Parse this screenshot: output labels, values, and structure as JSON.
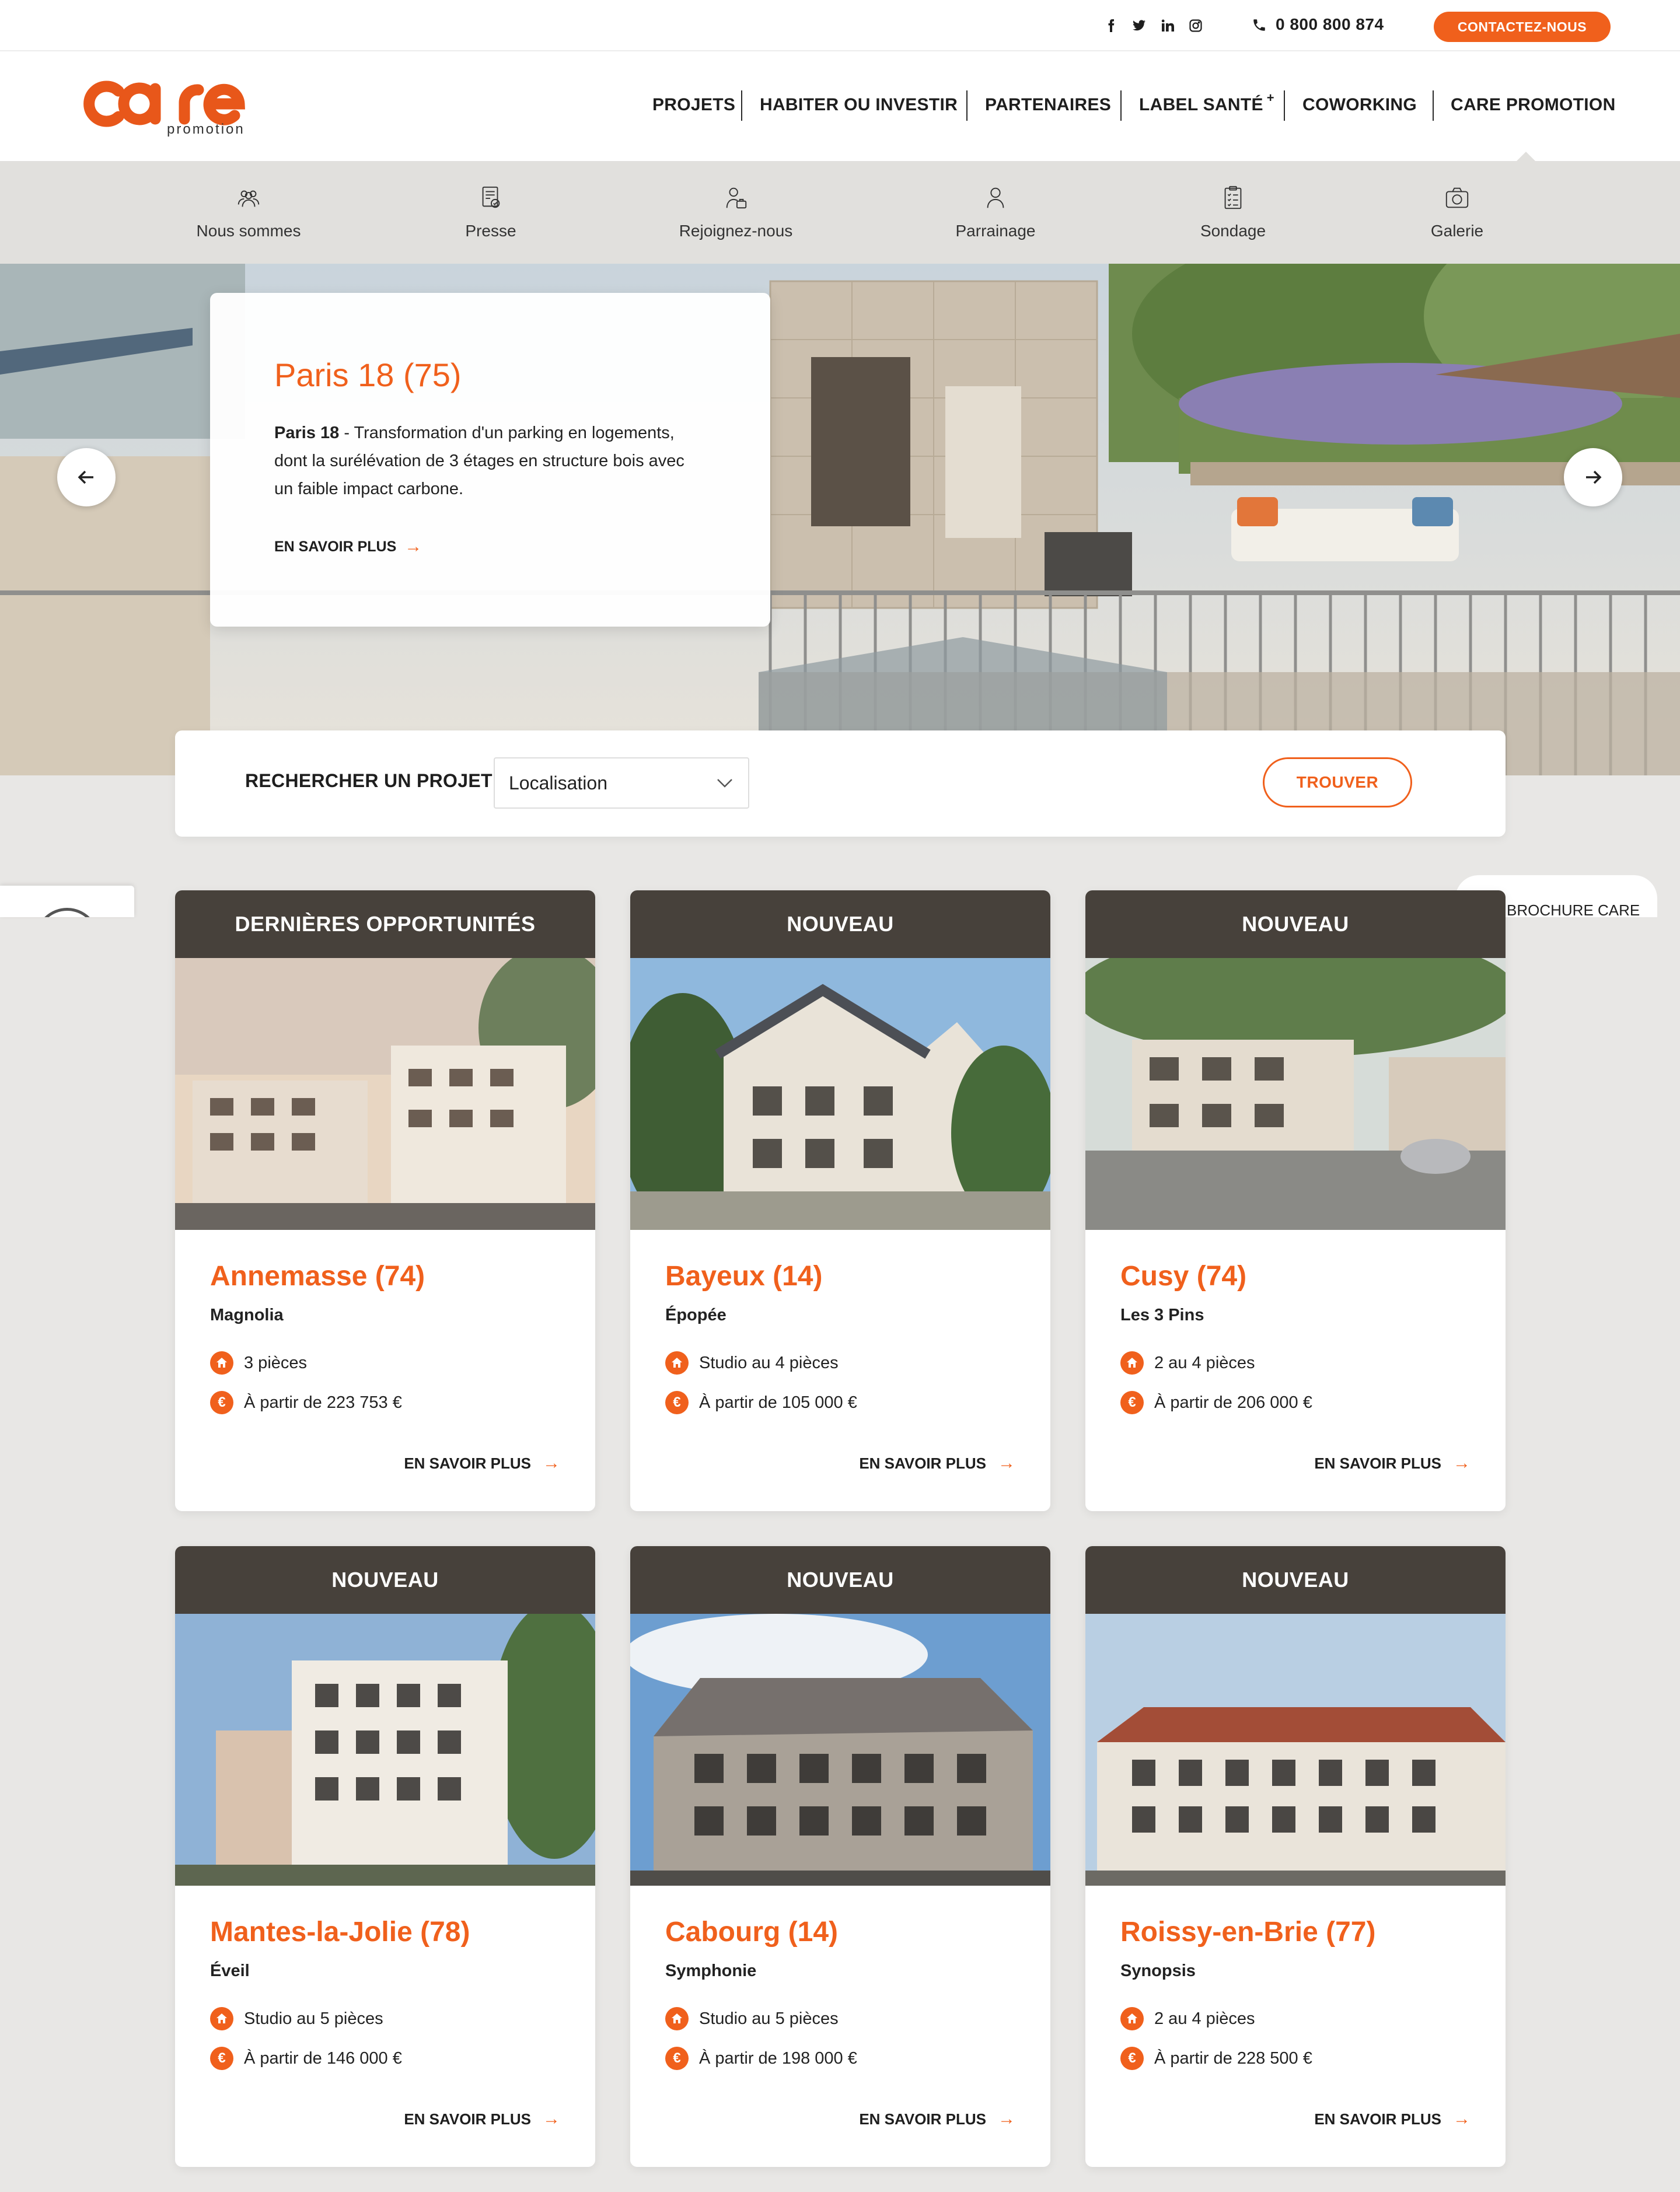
{
  "topbar": {
    "social": [
      "facebook-icon",
      "twitter-icon",
      "linkedin-icon",
      "instagram-icon"
    ],
    "phone": "0 800 800 874",
    "contact_label": "CONTACTEZ-NOUS"
  },
  "brand": {
    "name": "care",
    "subtitle": "promotion",
    "accent": "#f0601c",
    "dark": "#47413b"
  },
  "nav": {
    "items": [
      "PROJETS",
      "HABITER OU INVESTIR",
      "PARTENAIRES",
      "LABEL SANTÉ",
      "COWORKING",
      "CARE PROMOTION"
    ],
    "label_sante_sup": "+"
  },
  "subnav": {
    "items": [
      {
        "label": "Nous sommes",
        "icon": "people-icon"
      },
      {
        "label": "Presse",
        "icon": "press-icon"
      },
      {
        "label": "Rejoignez-nous",
        "icon": "recruit-icon"
      },
      {
        "label": "Parrainage",
        "icon": "user-icon"
      },
      {
        "label": "Sondage",
        "icon": "clipboard-icon"
      },
      {
        "label": "Galerie",
        "icon": "camera-icon"
      }
    ]
  },
  "hero": {
    "title": "Paris 18 (75)",
    "desc_bold": "Paris 18",
    "desc_rest": " - Transformation d'un parking en logements, dont la surélévation de 3 étages en structure bois avec un faible impact carbone.",
    "link": "EN SAVOIR PLUS"
  },
  "search": {
    "label": "RECHERCHER UN PROJET",
    "select_value": "Localisation",
    "button": "TROUVER"
  },
  "brochure": {
    "label": "BROCHURE CARE"
  },
  "cards": [
    {
      "badge": "DERNIÈRES OPPORTUNITÉS",
      "city": "Annemasse (74)",
      "program": "Magnolia",
      "rooms": "3 pièces",
      "price": "À partir de 223 753 €",
      "link": "EN SAVOIR PLUS"
    },
    {
      "badge": "NOUVEAU",
      "city": "Bayeux (14)",
      "program": "Épopée",
      "rooms": "Studio au 4 pièces",
      "price": "À partir de 105 000 €",
      "link": "EN SAVOIR PLUS"
    },
    {
      "badge": "NOUVEAU",
      "city": "Cusy (74)",
      "program": "Les 3 Pins",
      "rooms": "2 au 4 pièces",
      "price": "À partir de 206 000 €",
      "link": "EN SAVOIR PLUS"
    },
    {
      "badge": "NOUVEAU",
      "city": "Mantes-la-Jolie (78)",
      "program": "Éveil",
      "rooms": "Studio au 5 pièces",
      "price": "À partir de 146 000 €",
      "link": "EN SAVOIR PLUS"
    },
    {
      "badge": "NOUVEAU",
      "city": "Cabourg (14)",
      "program": "Symphonie",
      "rooms": "Studio au 5 pièces",
      "price": "À partir de 198 000 €",
      "link": "EN SAVOIR PLUS"
    },
    {
      "badge": "NOUVEAU",
      "city": "Roissy-en-Brie (77)",
      "program": "Synopsis",
      "rooms": "2 au 4 pièces",
      "price": "À partir de 228 500 €",
      "link": "EN SAVOIR PLUS"
    }
  ]
}
